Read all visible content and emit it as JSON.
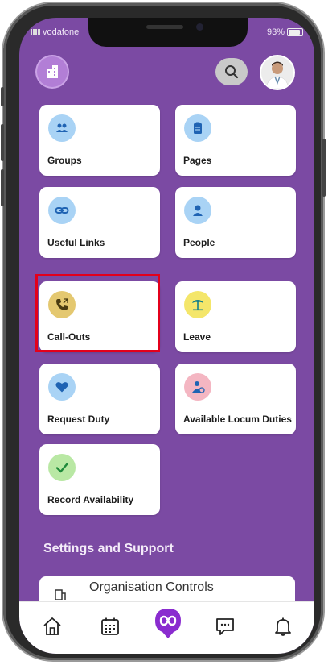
{
  "status_bar": {
    "carrier": "vodafone",
    "battery": "93%"
  },
  "header": {
    "logo_icon": "buildings-icon",
    "search_icon": "search-icon",
    "avatar_icon": "doctor-avatar"
  },
  "tiles": [
    {
      "label": "Groups",
      "icon": "groups-icon",
      "icon_bg": "#a9d3f5"
    },
    {
      "label": "Pages",
      "icon": "clipboard-icon",
      "icon_bg": "#a9d3f5"
    },
    {
      "label": "Useful Links",
      "icon": "link-icon",
      "icon_bg": "#a9d3f5"
    },
    {
      "label": "People",
      "icon": "person-icon",
      "icon_bg": "#a9d3f5"
    },
    {
      "label": "Call-Outs",
      "icon": "phone-callout-icon",
      "icon_bg": "#e4c870"
    },
    {
      "label": "Leave",
      "icon": "palm-tree-icon",
      "icon_bg": "#f4e66a"
    },
    {
      "label": "Request Duty",
      "icon": "heart-icon",
      "icon_bg": "#a9d3f5"
    },
    {
      "label": "Available Locum Duties",
      "icon": "locum-person-icon",
      "icon_bg": "#f4b6c2"
    },
    {
      "label": "Record Availability",
      "icon": "check-icon",
      "icon_bg": "#b9e8a4"
    }
  ],
  "settings": {
    "title": "Settings and Support",
    "org_controls_label": "Organisation Controls"
  },
  "tab_bar": {
    "items": [
      {
        "name": "home-icon"
      },
      {
        "name": "calendar-icon"
      },
      {
        "name": "infinity-icon"
      },
      {
        "name": "chat-icon"
      },
      {
        "name": "bell-icon"
      }
    ]
  },
  "colors": {
    "background": "#7b4aa3",
    "highlight": "#e3001b",
    "accent": "#8a2ccf"
  }
}
